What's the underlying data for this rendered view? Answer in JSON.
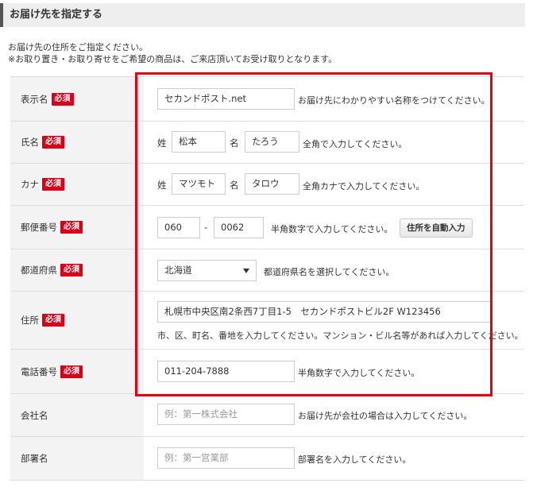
{
  "header": {
    "title": "お届け先を指定する"
  },
  "description": {
    "line1": "お届け先の住所をご指定ください。",
    "line2": "※お取り置き・お取り寄せをご希望の商品は、ご来店頂いてお受け取りとなります。"
  },
  "required_badge": "必須",
  "colors": {
    "required": "#d9001b",
    "highlight": "#e60012",
    "label_bg": "#f3f3f3"
  },
  "fields": {
    "display_name": {
      "label": "表示名",
      "value": "セカンドポスト.net",
      "hint": "お届け先にわかりやすい名称をつけてください。"
    },
    "name": {
      "label": "氏名",
      "sei_prefix": "姓",
      "sei_value": "松本",
      "mei_prefix": "名",
      "mei_value": "たろう",
      "hint": "全角で入力してください。"
    },
    "kana": {
      "label": "カナ",
      "sei_prefix": "姓",
      "sei_value": "マツモト",
      "mei_prefix": "名",
      "mei_value": "タロウ",
      "hint": "全角カナで入力してください。"
    },
    "postal": {
      "label": "郵便番号",
      "value1": "060",
      "separator": "-",
      "value2": "0062",
      "hint": "半角数字で入力してください。",
      "auto_button": "住所を自動入力"
    },
    "prefecture": {
      "label": "都道府県",
      "selected": "北海道",
      "hint": "都道府県名を選択してください。"
    },
    "address": {
      "label": "住所",
      "value": "札幌市中央区南2条西7丁目1-5　セカンドポストビル2F W123456",
      "hint": "市、区、町名、番地を入力してください。マンション・ビル名等があれば入力してください。"
    },
    "phone": {
      "label": "電話番号",
      "value": "011-204-7888",
      "hint": "半角数字で入力してください。"
    },
    "company": {
      "label": "会社名",
      "placeholder": "例：第一株式会社",
      "hint": "お届け先が会社の場合は入力してください。"
    },
    "department": {
      "label": "部署名",
      "placeholder": "例：第一営業部",
      "hint": "部署名を入力してください。"
    }
  }
}
